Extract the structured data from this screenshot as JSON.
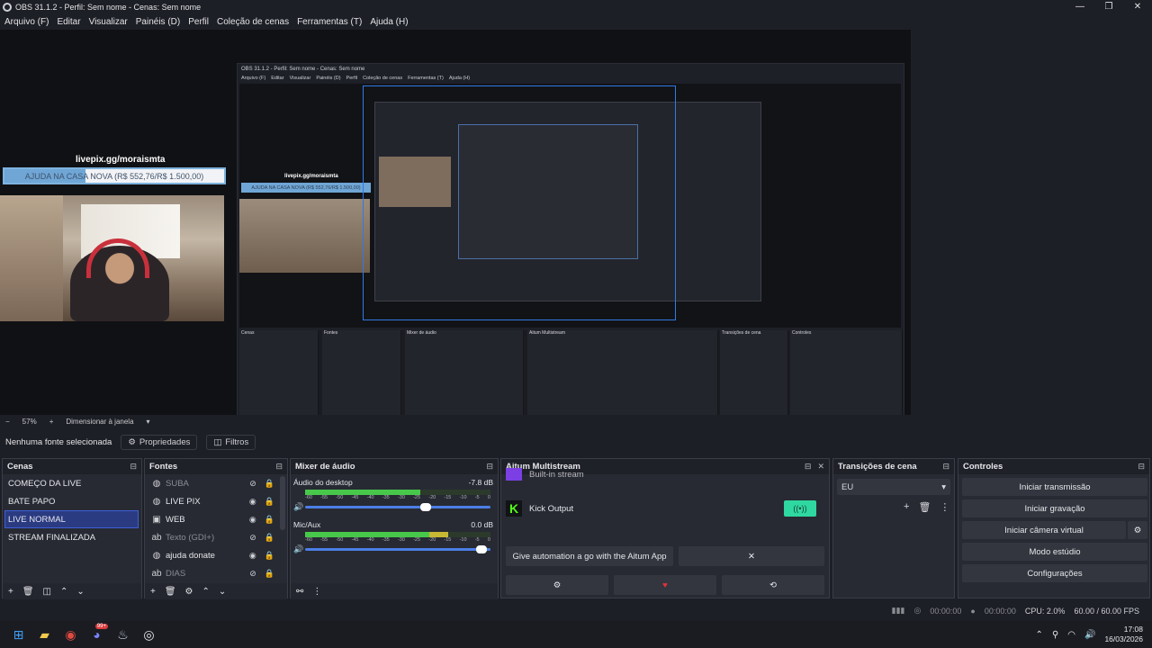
{
  "window": {
    "title": "OBS 31.1.2 - Perfil: Sem nome - Cenas: Sem nome",
    "controls": [
      "—",
      "❐",
      "✕"
    ]
  },
  "menu": [
    "Arquivo (F)",
    "Editar",
    "Visualizar",
    "Painéis (D)",
    "Perfil",
    "Coleção de cenas",
    "Ferramentas (T)",
    "Ajuda (H)"
  ],
  "preview": {
    "overlay_title": "livepix.gg/moraismta",
    "goal_text": "AJUDA NA CASA NOVA (R$ 552,76/R$ 1.500,00)",
    "goal_progress": 0.368
  },
  "zoom": {
    "level": "57%",
    "mode": "Dimensionar à janela"
  },
  "source_bar": {
    "no_source": "Nenhuma fonte selecionada",
    "properties": "Propriedades",
    "filters": "Filtros"
  },
  "scenes": {
    "title": "Cenas",
    "items": [
      "COMEÇO DA LIVE",
      "BATE PAPO",
      "LIVE NORMAL",
      "STREAM FINALIZADA"
    ],
    "active": "LIVE NORMAL"
  },
  "sources": {
    "title": "Fontes",
    "items": [
      {
        "name": "SUBA",
        "icon": "browser-icon",
        "visible": false
      },
      {
        "name": "LIVE PIX",
        "icon": "browser-icon",
        "visible": true
      },
      {
        "name": "WEB",
        "icon": "camera-icon",
        "visible": true
      },
      {
        "name": "Texto (GDI+)",
        "icon": "text-icon",
        "visible": false
      },
      {
        "name": "ajuda donate",
        "icon": "browser-icon",
        "visible": true
      },
      {
        "name": "DIAS",
        "icon": "text-icon",
        "visible": false
      }
    ]
  },
  "mixer": {
    "title": "Mixer de áudio",
    "channels": [
      {
        "name": "Áudio do desktop",
        "db": "-7.8 dB",
        "level": 0.62,
        "volume": 0.68
      },
      {
        "name": "Mic/Aux",
        "db": "0.0 dB",
        "level": 0.77,
        "volume": 0.98
      }
    ],
    "ticks": [
      "-60",
      "-55",
      "-50",
      "-45",
      "-40",
      "-35",
      "-30",
      "-25",
      "-20",
      "-15",
      "-10",
      "-5",
      "0"
    ]
  },
  "multistream": {
    "title": "Aitum Multistream",
    "cut_label": "Built-in stream",
    "output": "Kick Output",
    "automation": "Give automation a go with the Aitum App"
  },
  "transitions": {
    "title": "Transições de cena",
    "selected": "EU"
  },
  "controls": {
    "title": "Controles",
    "buttons": [
      "Iniciar transmissão",
      "Iniciar gravação",
      "Iniciar câmera virtual",
      "Modo estúdio",
      "Configurações"
    ]
  },
  "status": {
    "stream_time": "00:00:00",
    "rec_time": "00:00:00",
    "cpu": "CPU: 2.0%",
    "fps": "60.00 / 60.00 FPS"
  },
  "taskbar": {
    "time": "17:08",
    "date": "16/03/2026",
    "apps": [
      "windows-icon",
      "folder-icon",
      "chrome-icon",
      "discord-icon",
      "steam-icon",
      "obs-icon"
    ],
    "discord_badge": "99+"
  },
  "colors": {
    "accent": "#2b3b82",
    "goal_fill": "#6fa6d6",
    "kick_green": "#53fc18",
    "live_green": "#2ed8a0"
  }
}
